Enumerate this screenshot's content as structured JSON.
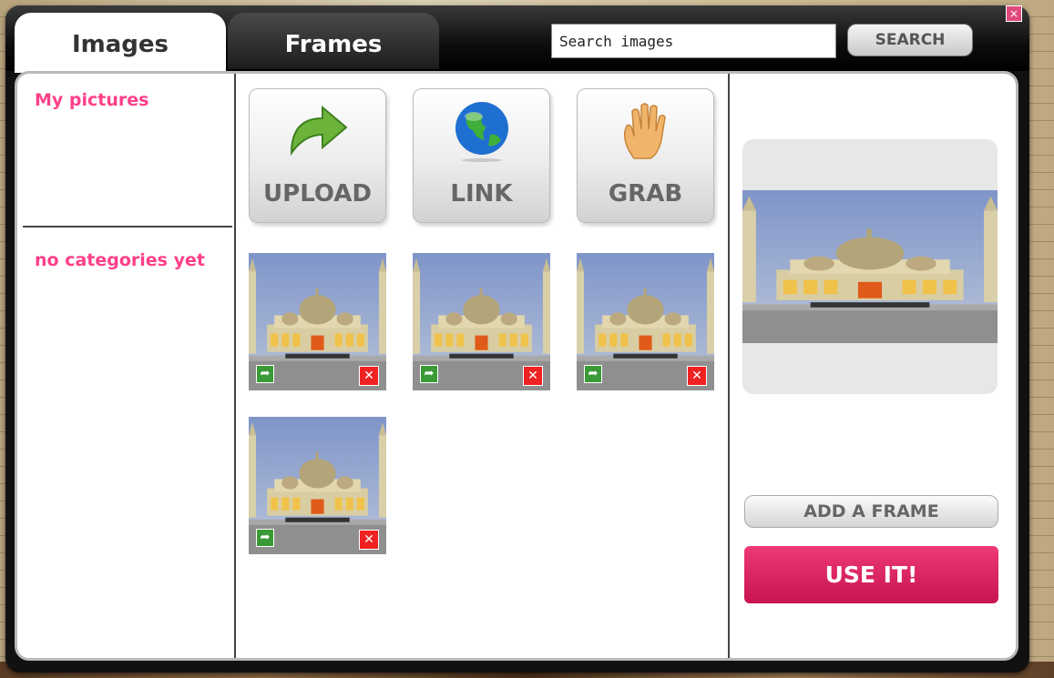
{
  "tabs": {
    "images_label": "Images",
    "frames_label": "Frames"
  },
  "search": {
    "placeholder": "Search images",
    "button_label": "SEARCH"
  },
  "window": {
    "close_label": "×"
  },
  "sidebar": {
    "heading": "My pictures",
    "empty_categories": "no categories yet"
  },
  "actions": [
    {
      "label": "UPLOAD",
      "icon": "green-arrow-icon"
    },
    {
      "label": "LINK",
      "icon": "globe-icon"
    },
    {
      "label": "GRAB",
      "icon": "hand-icon"
    }
  ],
  "thumbnails": [
    {
      "subject": "mosque",
      "use_symbol": "➦",
      "delete_symbol": "✕"
    },
    {
      "subject": "mosque",
      "use_symbol": "➦",
      "delete_symbol": "✕"
    },
    {
      "subject": "mosque",
      "use_symbol": "➦",
      "delete_symbol": "✕"
    },
    {
      "subject": "mosque",
      "use_symbol": "➦",
      "delete_symbol": "✕"
    }
  ],
  "preview": {
    "add_frame_label": "ADD A FRAME",
    "use_it_label": "USE IT!"
  },
  "colors": {
    "accent_pink": "#ff3f8a",
    "use_it_pink": "#d91f5f",
    "thumb_use_green": "#3a9a35",
    "thumb_delete_red": "#ee2222"
  }
}
